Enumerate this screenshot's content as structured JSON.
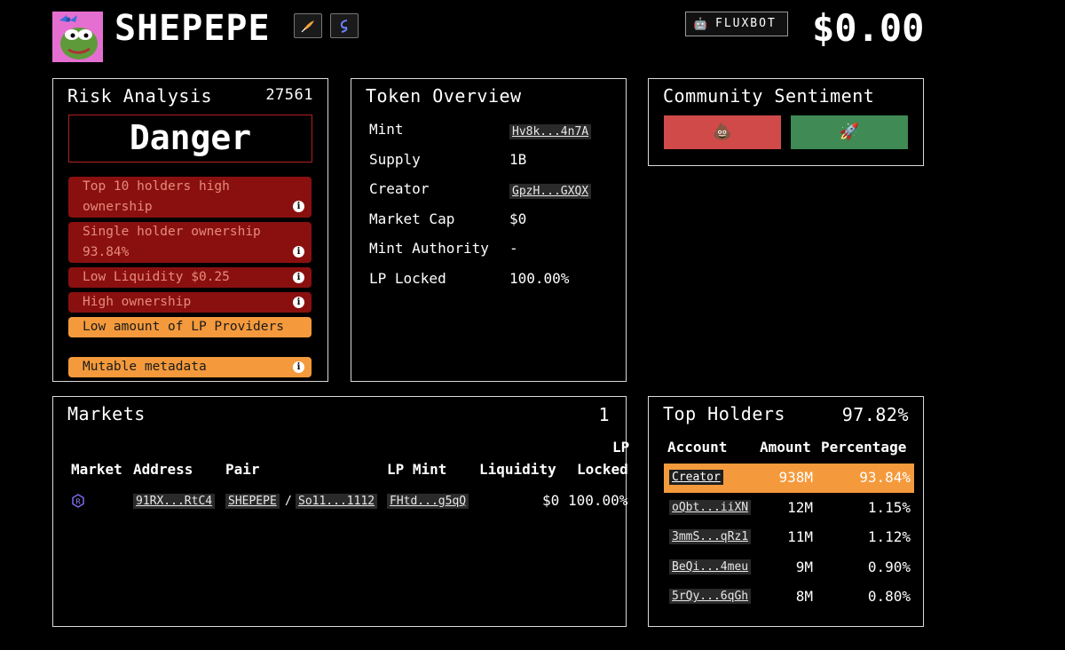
{
  "header": {
    "token_name": "SHEPEPE",
    "bot_label": "FLUXBOT",
    "price": "$0.00"
  },
  "risk": {
    "title": "Risk Analysis",
    "score": "27561",
    "level": "Danger",
    "items": [
      {
        "line1": "Top 10 holders high",
        "line2": "ownership",
        "severity": "danger"
      },
      {
        "line1": "Single holder ownership",
        "line2": "93.84%",
        "severity": "danger"
      },
      {
        "line1": "Low Liquidity $0.25",
        "line2": "",
        "severity": "danger"
      },
      {
        "line1": "High ownership",
        "line2": "",
        "severity": "danger"
      },
      {
        "line1": "Low amount of LP Providers",
        "line2": "",
        "severity": "warning"
      },
      {
        "line1": "Mutable metadata",
        "line2": "",
        "severity": "warning"
      }
    ],
    "colors": {
      "danger": "#8a1010",
      "warning": "#f49a3c"
    }
  },
  "overview": {
    "title": "Token Overview",
    "rows": [
      {
        "label": "Mint",
        "value": "Hv8k...4n7A",
        "link": true
      },
      {
        "label": "Supply",
        "value": "1B",
        "link": false
      },
      {
        "label": "Creator",
        "value": "GpzH...GXQX",
        "link": true
      },
      {
        "label": "Market Cap",
        "value": "$0",
        "link": false
      },
      {
        "label": "Mint Authority",
        "value": "-",
        "link": false
      },
      {
        "label": "LP Locked",
        "value": "100.00%",
        "link": false
      }
    ]
  },
  "sentiment": {
    "title": "Community Sentiment",
    "negative_icon": "poop-emoji",
    "positive_icon": "rocket-emoji",
    "negative_color": "#d04a4a",
    "positive_color": "#3f8a55"
  },
  "markets": {
    "title": "Markets",
    "count": "1",
    "columns": [
      "Market",
      "Address",
      "Pair",
      "LP Mint",
      "Liquidity",
      "LP",
      "Locked"
    ],
    "rows": [
      {
        "icon": "raydium-icon",
        "address": "91RX...RtC4",
        "pair_base": "SHEPEPE",
        "pair_sep": "/",
        "pair_quote": "So11...1112",
        "lp_mint": "FHtd...g5qQ",
        "liquidity": "$0",
        "lp_locked": "100.00%"
      }
    ]
  },
  "holders": {
    "title": "Top Holders",
    "total": "97.82%",
    "columns": [
      "Account",
      "Amount",
      "Percentage"
    ],
    "rows": [
      {
        "account": "Creator",
        "amount": "938M",
        "percentage": "93.84%",
        "highlight": true
      },
      {
        "account": "oQbt...iiXN",
        "amount": "12M",
        "percentage": "1.15%",
        "highlight": false
      },
      {
        "account": "3mmS...qRz1",
        "amount": "11M",
        "percentage": "1.12%",
        "highlight": false
      },
      {
        "account": "BeQi...4meu",
        "amount": "9M",
        "percentage": "0.90%",
        "highlight": false
      },
      {
        "account": "5rQy...6qGh",
        "amount": "8M",
        "percentage": "0.80%",
        "highlight": false
      }
    ],
    "highlight_color": "#f49a3c"
  }
}
